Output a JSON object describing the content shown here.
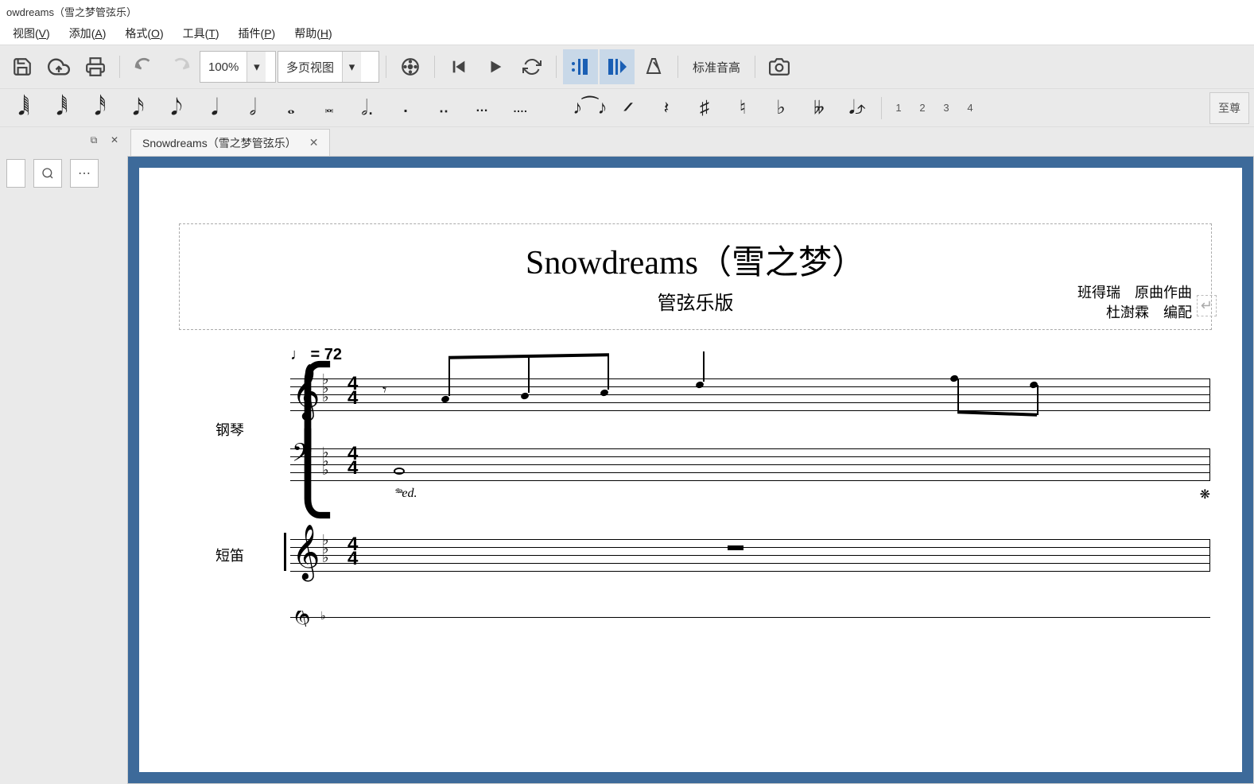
{
  "window": {
    "title": "owdreams（雪之梦管弦乐）"
  },
  "menu": {
    "view": "视图",
    "view_key": "V",
    "add": "添加",
    "add_key": "A",
    "format": "格式",
    "format_key": "O",
    "tools": "工具",
    "tools_key": "T",
    "plugins": "插件",
    "plugins_key": "P",
    "help": "帮助",
    "help_key": "H"
  },
  "toolbar": {
    "zoom": "100%",
    "view_mode": "多页视图",
    "pitch_label": "标准音高"
  },
  "note_toolbar": {
    "voices": [
      "1",
      "2",
      "3",
      "4"
    ],
    "right_btn": "至尊"
  },
  "tab": {
    "label": "Snowdreams（雪之梦管弦乐）"
  },
  "score": {
    "title": "Snowdreams（雪之梦）",
    "subtitle": "管弦乐版",
    "credit1": "班得瑞　原曲作曲",
    "credit2": "杜澍霖　编配",
    "tempo_note": "♩",
    "tempo_eq": " = 72",
    "instrument1": "钢琴",
    "instrument2": "短笛",
    "time_top": "4",
    "time_bottom": "4",
    "pedal": "𝆮𝆯."
  }
}
